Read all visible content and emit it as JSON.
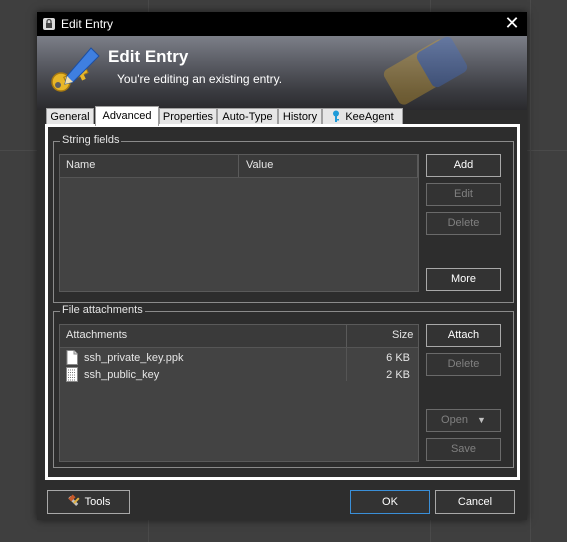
{
  "window": {
    "title": "Edit Entry"
  },
  "banner": {
    "title": "Edit Entry",
    "subtitle": "You're editing an existing entry."
  },
  "tabs": [
    {
      "label": "General"
    },
    {
      "label": "Advanced"
    },
    {
      "label": "Properties"
    },
    {
      "label": "Auto-Type"
    },
    {
      "label": "History"
    },
    {
      "label": "KeeAgent"
    }
  ],
  "active_tab": "Advanced",
  "string_fields": {
    "legend": "String fields",
    "columns": [
      "Name",
      "Value"
    ],
    "buttons": {
      "add": "Add",
      "edit": "Edit",
      "delete": "Delete",
      "more": "More"
    }
  },
  "file_attachments": {
    "legend": "File attachments",
    "columns": [
      "Attachments",
      "Size"
    ],
    "files": [
      {
        "name": "ssh_private_key.ppk",
        "size": "6 KB",
        "icon": "file-icon"
      },
      {
        "name": "ssh_public_key",
        "size": "2 KB",
        "icon": "text-file-icon"
      }
    ],
    "buttons": {
      "attach": "Attach",
      "delete": "Delete",
      "open": "Open",
      "save": "Save"
    }
  },
  "footer": {
    "tools": "Tools",
    "ok": "OK",
    "cancel": "Cancel"
  },
  "colors": {
    "accent": "#3a8fd8",
    "background": "#2d2d2d",
    "banner": "#5c5e66"
  }
}
